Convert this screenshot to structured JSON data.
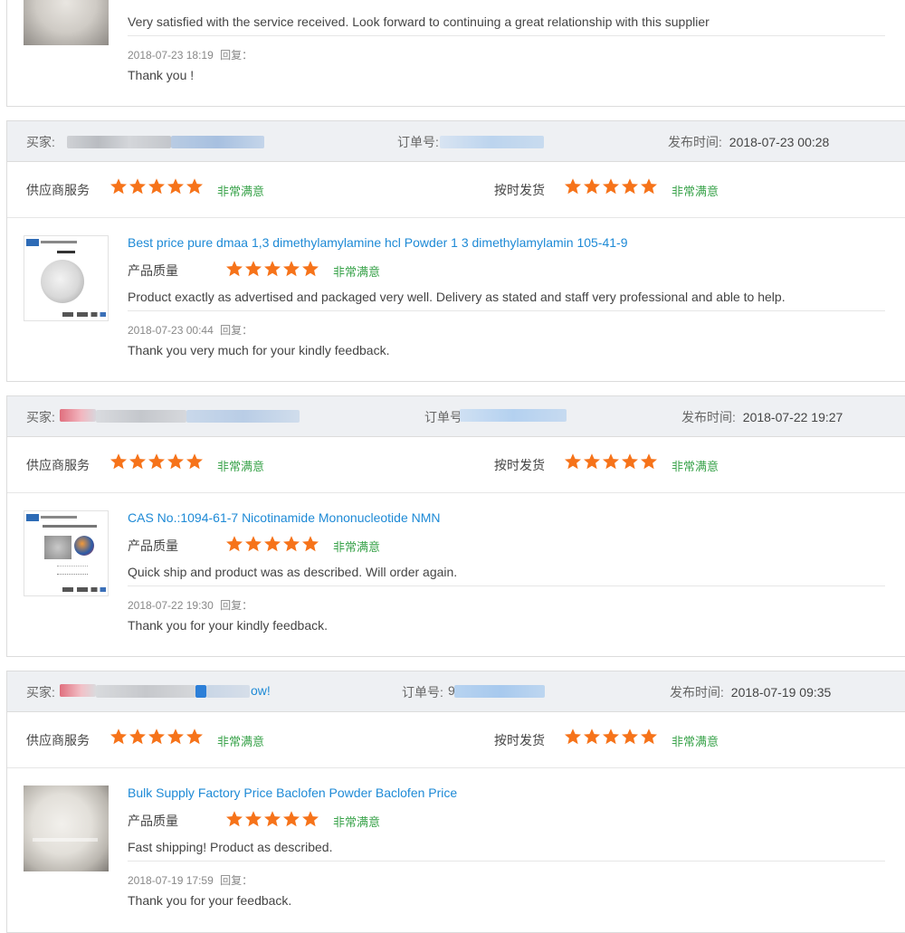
{
  "colors": {
    "star": "#f6731a",
    "rating_text": "#3aa34b",
    "link": "#1e8ad6",
    "header_bg": "#eef0f3"
  },
  "labels": {
    "buyer": "买家:",
    "order": "订单号:",
    "publish_time": "发布时间:",
    "supplier_service": "供应商服务",
    "on_time_shipping": "按时发货",
    "product_quality": "产品质量",
    "rating_very_satisfied": "非常满意",
    "reply": "回复："
  },
  "top_review": {
    "comment": "Very satisfied with the service received. Look forward to continuing a great relationship with this supplier",
    "reply_time": "2018-07-23 18:19",
    "reply_text": "Thank you !"
  },
  "reviews": [
    {
      "publish_time": "2018-07-23 00:28",
      "product_title": "Best price pure dmaa 1,3 dimethylamylamine hcl Powder 1 3 dimethylamylamin 105-41-9",
      "comment": "Product exactly as advertised and packaged very well. Delivery as stated and staff very professional and able to help.",
      "reply_time": "2018-07-23 00:44",
      "reply_text": "Thank you very much for your kindly feedback."
    },
    {
      "publish_time": "2018-07-22 19:27",
      "product_title": "CAS No.:1094-61-7 Nicotinamide Mononucleotide NMN",
      "comment": "Quick ship and product was as described. Will order again.",
      "reply_time": "2018-07-22 19:30",
      "reply_text": "Thank you for your kindly feedback."
    },
    {
      "publish_time": "2018-07-19 09:35",
      "buyer_suffix": "ow!",
      "order_prefix": "9",
      "product_title": "Bulk Supply Factory Price Baclofen Powder Baclofen Price",
      "comment": "Fast shipping! Product as described.",
      "reply_time": "2018-07-19 17:59",
      "reply_text": "Thank you for your feedback."
    }
  ],
  "ratings": {
    "supplier_service_stars": 5,
    "on_time_shipping_stars": 5,
    "product_quality_stars": 5,
    "max_stars": 5
  }
}
